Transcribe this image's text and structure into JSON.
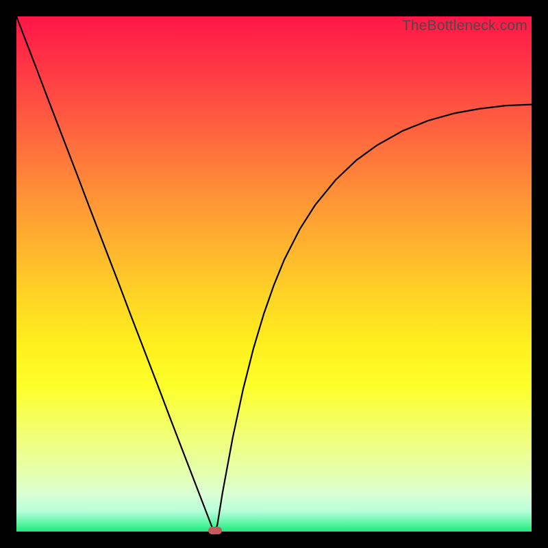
{
  "watermark": "TheBottleneck.com",
  "colors": {
    "frame": "#000000",
    "curve": "#000000",
    "marker": "#c65a5a"
  },
  "chart_data": {
    "type": "line",
    "title": "",
    "xlabel": "",
    "ylabel": "",
    "xlim": [
      0,
      100
    ],
    "ylim": [
      0,
      100
    ],
    "grid": false,
    "x": [
      0,
      2,
      4,
      6,
      8,
      10,
      12,
      14,
      16,
      18,
      20,
      22,
      24,
      26,
      28,
      30,
      32,
      34,
      36,
      37.5,
      38,
      38.5,
      39,
      40,
      42,
      44,
      46,
      48,
      50,
      52,
      55,
      58,
      62,
      66,
      70,
      75,
      80,
      85,
      90,
      95,
      100
    ],
    "y": [
      100,
      94.8,
      89.6,
      84.3,
      79.1,
      73.9,
      68.7,
      63.4,
      58.2,
      53.0,
      47.8,
      42.5,
      37.3,
      32.1,
      26.9,
      21.6,
      16.4,
      11.2,
      6.0,
      2.1,
      0.8,
      0.0,
      1.3,
      7.5,
      18.3,
      27.6,
      35.5,
      42.2,
      47.9,
      52.8,
      58.7,
      63.4,
      68.3,
      72.1,
      75.0,
      77.8,
      79.8,
      81.2,
      82.1,
      82.7,
      82.9
    ],
    "min_point": {
      "x": 38.5,
      "y": 0.0
    },
    "annotations": []
  }
}
